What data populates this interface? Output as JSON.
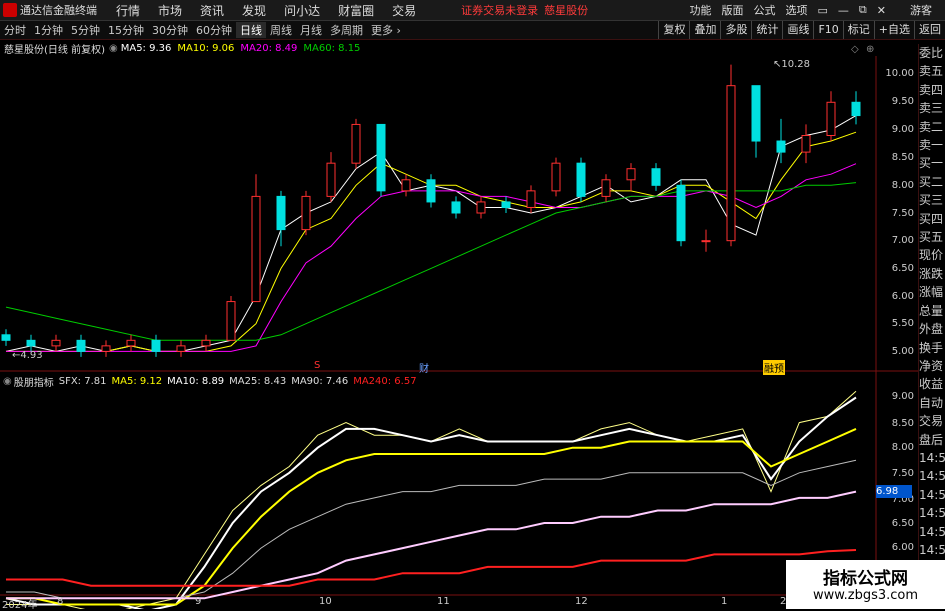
{
  "app": {
    "title": "通达信金融终端",
    "login_warning": "证券交易未登录",
    "stock_link": "慈星股份",
    "guest": "游客"
  },
  "menu": [
    "行情",
    "市场",
    "资讯",
    "发现",
    "问小达",
    "财富圈",
    "交易"
  ],
  "title_right": [
    "功能",
    "版面",
    "公式",
    "选项"
  ],
  "window_buttons": [
    "▭",
    "—",
    "⧉",
    "✕"
  ],
  "periods": [
    {
      "label": "分时",
      "active": false
    },
    {
      "label": "1分钟",
      "active": false
    },
    {
      "label": "5分钟",
      "active": false
    },
    {
      "label": "15分钟",
      "active": false
    },
    {
      "label": "30分钟",
      "active": false
    },
    {
      "label": "60分钟",
      "active": false
    },
    {
      "label": "日线",
      "active": true
    },
    {
      "label": "周线",
      "active": false
    },
    {
      "label": "月线",
      "active": false
    },
    {
      "label": "多周期",
      "active": false
    },
    {
      "label": "更多 ›",
      "active": false
    }
  ],
  "tool_right": [
    "复权",
    "叠加",
    "多股",
    "统计",
    "画线",
    "F10",
    "标记",
    "+自选",
    "返回"
  ],
  "main_header": {
    "stock": "慈星股份(日线 前复权)",
    "ma5": "MA5: 9.36",
    "ma10": "MA10: 9.06",
    "ma20": "MA20: 8.49",
    "ma60": "MA60: 8.15"
  },
  "ind_header": {
    "name": "股朋指标",
    "sfx": "SFX: 7.81",
    "ma5": "MA5: 9.12",
    "ma10": "MA10: 8.89",
    "ma25": "MA25: 8.43",
    "ma90": "MA90: 7.46",
    "ma240": "MA240: 6.57"
  },
  "main_axis": [
    "10.00",
    "9.50",
    "9.00",
    "8.50",
    "8.00",
    "7.50",
    "7.00",
    "6.50",
    "6.00",
    "5.50",
    "5.00"
  ],
  "ind_axis": [
    "9.00",
    "8.50",
    "8.00",
    "7.50",
    "7.00",
    "6.50",
    "6.00"
  ],
  "ind_value_tag": "6.98",
  "annotations": {
    "high": "10.28",
    "low": "4.93",
    "marker1": "S",
    "marker2": "财",
    "marker3": "融预"
  },
  "side_panel": [
    "委比",
    "卖五",
    "卖四",
    "卖三",
    "卖二",
    "卖一",
    "买一",
    "买二",
    "买三",
    "买四",
    "买五",
    "现价",
    "涨跌",
    "涨幅",
    "总量",
    "外盘",
    "换手",
    "净资",
    "收益",
    "自动",
    "交易",
    "盘后",
    "14:56",
    "14:56",
    "14:56",
    "14:56",
    "14:56",
    "14:56",
    "14:56"
  ],
  "dates": [
    "2024年",
    "8",
    "9",
    "10",
    "11",
    "12",
    "1",
    "2"
  ],
  "watermark": {
    "line1": "指标公式网",
    "line2": "www.zbgs3.com"
  },
  "colors": {
    "up": "#ff3030",
    "down": "#00e0e0",
    "ma5": "#ffffff",
    "ma10": "#ffff00",
    "ma20": "#ff00ff",
    "ma60": "#00cc00",
    "ma240": "#ff2020"
  },
  "chart_data": [
    {
      "type": "candlestick",
      "title": "慈星股份(日线 前复权)",
      "ylim": [
        4.8,
        10.4
      ],
      "series": [
        {
          "name": "MA5",
          "values": [
            5.1,
            5.2,
            5.1,
            5.2,
            5.1,
            5.2,
            5.1,
            5.1,
            5.2,
            5.3,
            6.1,
            7.3,
            7.6,
            7.8,
            8.4,
            8.7,
            8.0,
            8.1,
            8.0,
            7.7,
            7.7,
            7.6,
            7.7,
            7.9,
            8.1,
            7.8,
            7.9,
            8.2,
            8.2,
            7.4,
            7.2,
            8.8,
            9.0,
            9.1,
            9.36
          ]
        },
        {
          "name": "MA10",
          "values": [
            5.1,
            5.1,
            5.1,
            5.1,
            5.1,
            5.2,
            5.1,
            5.1,
            5.1,
            5.2,
            5.6,
            6.6,
            7.3,
            7.5,
            8.1,
            8.5,
            8.3,
            8.1,
            8.1,
            7.9,
            7.8,
            7.7,
            7.7,
            7.8,
            8.0,
            8.0,
            7.9,
            8.1,
            8.1,
            7.8,
            7.5,
            8.2,
            8.8,
            8.9,
            9.06
          ]
        },
        {
          "name": "MA20",
          "values": [
            5.1,
            5.1,
            5.1,
            5.1,
            5.1,
            5.1,
            5.1,
            5.1,
            5.1,
            5.1,
            5.2,
            6.0,
            6.7,
            7.0,
            7.5,
            7.9,
            8.0,
            8.0,
            8.0,
            7.9,
            7.9,
            7.8,
            7.7,
            7.7,
            7.8,
            7.9,
            7.9,
            7.9,
            8.0,
            7.9,
            7.7,
            7.9,
            8.2,
            8.3,
            8.49
          ]
        },
        {
          "name": "MA60",
          "values": [
            5.9,
            5.8,
            5.7,
            5.6,
            5.5,
            5.4,
            5.3,
            5.3,
            5.3,
            5.3,
            5.3,
            5.4,
            5.6,
            5.8,
            6.0,
            6.2,
            6.4,
            6.6,
            6.8,
            7.0,
            7.2,
            7.4,
            7.6,
            7.7,
            7.8,
            7.9,
            7.9,
            8.0,
            8.0,
            8.0,
            8.0,
            8.0,
            8.1,
            8.1,
            8.15
          ]
        }
      ],
      "candles": [
        [
          5.4,
          5.3,
          5.5,
          5.2
        ],
        [
          5.3,
          5.2,
          5.4,
          5.1
        ],
        [
          5.2,
          5.3,
          5.4,
          5.1
        ],
        [
          5.3,
          5.1,
          5.4,
          5.0
        ],
        [
          5.1,
          5.2,
          5.3,
          5.0
        ],
        [
          5.2,
          5.3,
          5.4,
          5.1
        ],
        [
          5.3,
          5.1,
          5.4,
          5.0
        ],
        [
          5.1,
          5.2,
          5.3,
          5.0
        ],
        [
          5.2,
          5.3,
          5.4,
          5.1
        ],
        [
          5.3,
          6.0,
          6.1,
          5.3
        ],
        [
          6.0,
          7.9,
          8.3,
          6.0
        ],
        [
          7.9,
          7.3,
          8.0,
          7.0
        ],
        [
          7.3,
          7.9,
          8.0,
          7.2
        ],
        [
          7.9,
          8.5,
          8.7,
          7.8
        ],
        [
          8.5,
          9.2,
          9.3,
          8.4
        ],
        [
          9.2,
          8.0,
          9.2,
          7.9
        ],
        [
          8.0,
          8.2,
          8.3,
          7.9
        ],
        [
          8.2,
          7.8,
          8.3,
          7.7
        ],
        [
          7.8,
          7.6,
          7.9,
          7.5
        ],
        [
          7.6,
          7.8,
          7.9,
          7.5
        ],
        [
          7.8,
          7.7,
          7.9,
          7.6
        ],
        [
          7.7,
          8.0,
          8.1,
          7.6
        ],
        [
          8.0,
          8.5,
          8.6,
          7.9
        ],
        [
          8.5,
          7.9,
          8.6,
          7.8
        ],
        [
          7.9,
          8.2,
          8.3,
          7.8
        ],
        [
          8.2,
          8.4,
          8.5,
          8.0
        ],
        [
          8.4,
          8.1,
          8.5,
          8.0
        ],
        [
          8.1,
          7.1,
          8.2,
          7.0
        ],
        [
          7.1,
          7.1,
          7.3,
          6.9
        ],
        [
          7.1,
          9.9,
          10.28,
          7.0
        ],
        [
          9.9,
          8.9,
          9.9,
          8.6
        ],
        [
          8.9,
          8.7,
          9.3,
          8.5
        ],
        [
          8.7,
          9.0,
          9.2,
          8.5
        ],
        [
          9.0,
          9.6,
          9.8,
          8.9
        ],
        [
          9.6,
          9.36,
          9.8,
          9.2
        ]
      ]
    },
    {
      "type": "line",
      "title": "股朋指标",
      "ylim": [
        5.9,
        9.2
      ],
      "series": [
        {
          "name": "SFX",
          "values": [
            5.7,
            5.7,
            5.7,
            5.6,
            5.6,
            5.7,
            5.8,
            6.5,
            7.2,
            7.6,
            7.9,
            8.4,
            8.6,
            8.4,
            8.4,
            8.3,
            8.5,
            8.3,
            8.3,
            8.3,
            8.3,
            8.5,
            8.6,
            8.4,
            8.3,
            8.4,
            8.5,
            7.5,
            8.6,
            8.7,
            9.1
          ]
        },
        {
          "name": "MA5",
          "values": [
            5.8,
            5.7,
            5.7,
            5.7,
            5.7,
            5.6,
            5.7,
            6.3,
            7.0,
            7.5,
            7.8,
            8.2,
            8.5,
            8.5,
            8.4,
            8.3,
            8.4,
            8.3,
            8.3,
            8.3,
            8.3,
            8.4,
            8.5,
            8.4,
            8.3,
            8.3,
            8.4,
            7.7,
            8.3,
            8.7,
            9.0
          ]
        },
        {
          "name": "MA10",
          "values": [
            5.8,
            5.8,
            5.7,
            5.7,
            5.7,
            5.7,
            5.7,
            6.0,
            6.6,
            7.1,
            7.5,
            7.8,
            8.0,
            8.1,
            8.1,
            8.1,
            8.1,
            8.1,
            8.1,
            8.1,
            8.2,
            8.2,
            8.3,
            8.3,
            8.3,
            8.3,
            8.3,
            7.9,
            8.1,
            8.3,
            8.5
          ]
        },
        {
          "name": "MA25",
          "values": [
            5.9,
            5.9,
            5.8,
            5.8,
            5.8,
            5.8,
            5.8,
            5.9,
            6.2,
            6.6,
            6.9,
            7.1,
            7.3,
            7.4,
            7.5,
            7.5,
            7.6,
            7.6,
            7.6,
            7.7,
            7.7,
            7.7,
            7.8,
            7.8,
            7.8,
            7.8,
            7.8,
            7.6,
            7.8,
            7.9,
            8.0
          ]
        },
        {
          "name": "MA90",
          "values": [
            5.8,
            5.8,
            5.8,
            5.8,
            5.8,
            5.8,
            5.8,
            5.8,
            5.9,
            6.0,
            6.1,
            6.2,
            6.4,
            6.5,
            6.6,
            6.7,
            6.8,
            6.9,
            6.9,
            7.0,
            7.0,
            7.1,
            7.1,
            7.2,
            7.2,
            7.3,
            7.3,
            7.3,
            7.4,
            7.4,
            7.5
          ]
        },
        {
          "name": "MA240",
          "values": [
            6.1,
            6.1,
            6.1,
            6.0,
            6.0,
            6.0,
            6.0,
            6.0,
            6.0,
            6.0,
            6.0,
            6.1,
            6.1,
            6.1,
            6.2,
            6.2,
            6.2,
            6.3,
            6.3,
            6.3,
            6.3,
            6.4,
            6.4,
            6.4,
            6.4,
            6.5,
            6.5,
            6.5,
            6.5,
            6.55,
            6.57
          ]
        }
      ]
    }
  ]
}
